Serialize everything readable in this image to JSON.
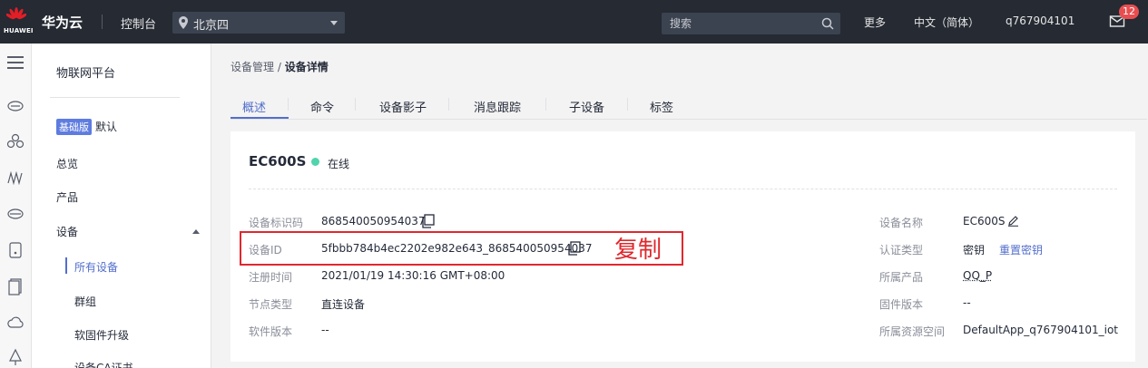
{
  "topbar": {
    "logo_text": "HUAWEI",
    "brand": "华为云",
    "console": "控制台",
    "region": "北京四",
    "search_placeholder": "搜索",
    "more": "更多",
    "language": "中文（简体）",
    "user": "q767904101",
    "mail_count": "12"
  },
  "sidebar": {
    "title": "物联网平台",
    "version_tag": "基础版",
    "version_default": "默认",
    "items": [
      "总览",
      "产品",
      "设备"
    ],
    "sub_items": [
      "所有设备",
      "群组",
      "软固件升级",
      "设备CA证书"
    ],
    "active_sub": "所有设备"
  },
  "breadcrumb": {
    "parent": "设备管理",
    "separator": "/",
    "current": "设备详情"
  },
  "tabs": [
    "概述",
    "命令",
    "设备影子",
    "消息跟踪",
    "子设备",
    "标签"
  ],
  "active_tab": "概述",
  "device": {
    "name": "EC600S",
    "status": "在线",
    "status_color": "#50d4ab",
    "left_fields": [
      {
        "label": "设备标识码",
        "value": "868540050954037"
      },
      {
        "label": "设备ID",
        "value": "5fbbb784b4ec2202e982e643_868540050954037"
      },
      {
        "label": "注册时间",
        "value": "2021/01/19 14:30:16 GMT+08:00"
      },
      {
        "label": "节点类型",
        "value": "直连设备"
      },
      {
        "label": "软件版本",
        "value": "--"
      }
    ],
    "right_fields": [
      {
        "label": "设备名称",
        "value": "EC600S"
      },
      {
        "label": "认证类型",
        "value": "密钥",
        "action": "重置密钥"
      },
      {
        "label": "所属产品",
        "value": "QQ_P"
      },
      {
        "label": "固件版本",
        "value": "--"
      },
      {
        "label": "所属资源空间",
        "value": "DefaultApp_q767904101_iot"
      }
    ]
  },
  "annotation": {
    "text": "复制",
    "color": "#e0282e"
  },
  "colors": {
    "accent": "#526ecc",
    "topbar": "#252a33"
  }
}
